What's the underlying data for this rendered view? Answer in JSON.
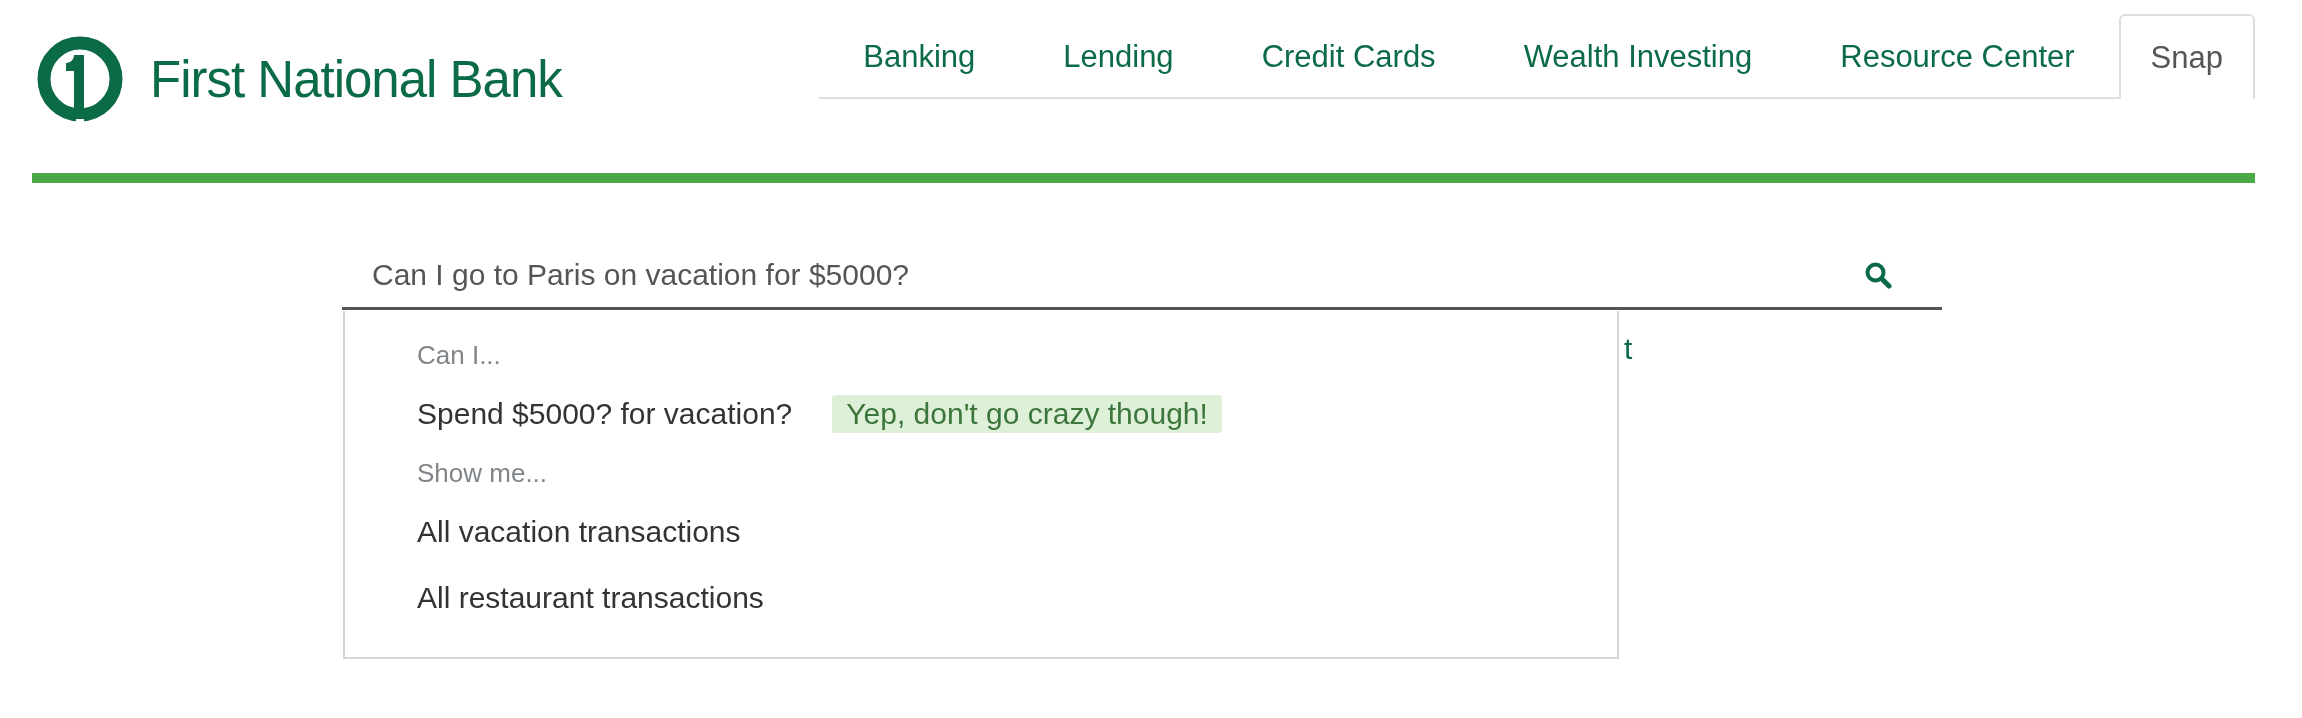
{
  "logo": {
    "text": "First National Bank"
  },
  "nav": {
    "tabs": [
      {
        "label": "Banking",
        "selected": false
      },
      {
        "label": "Lending",
        "selected": false
      },
      {
        "label": "Credit Cards",
        "selected": false
      },
      {
        "label": "Wealth Investing",
        "selected": false
      },
      {
        "label": "Resource Center",
        "selected": false
      },
      {
        "label": "Snap",
        "selected": true
      }
    ]
  },
  "search": {
    "value": "Can I go to Paris on vacation for $5000?"
  },
  "covered_text": "t",
  "suggestions": [
    {
      "header": "Can I...",
      "items": [
        {
          "label": "Spend $5000? for vacation?",
          "answer": "Yep, don't go crazy though!"
        }
      ]
    },
    {
      "header": "Show me...",
      "items": [
        {
          "label": "All vacation transactions"
        },
        {
          "label": "All restaurant transactions"
        }
      ]
    }
  ]
}
